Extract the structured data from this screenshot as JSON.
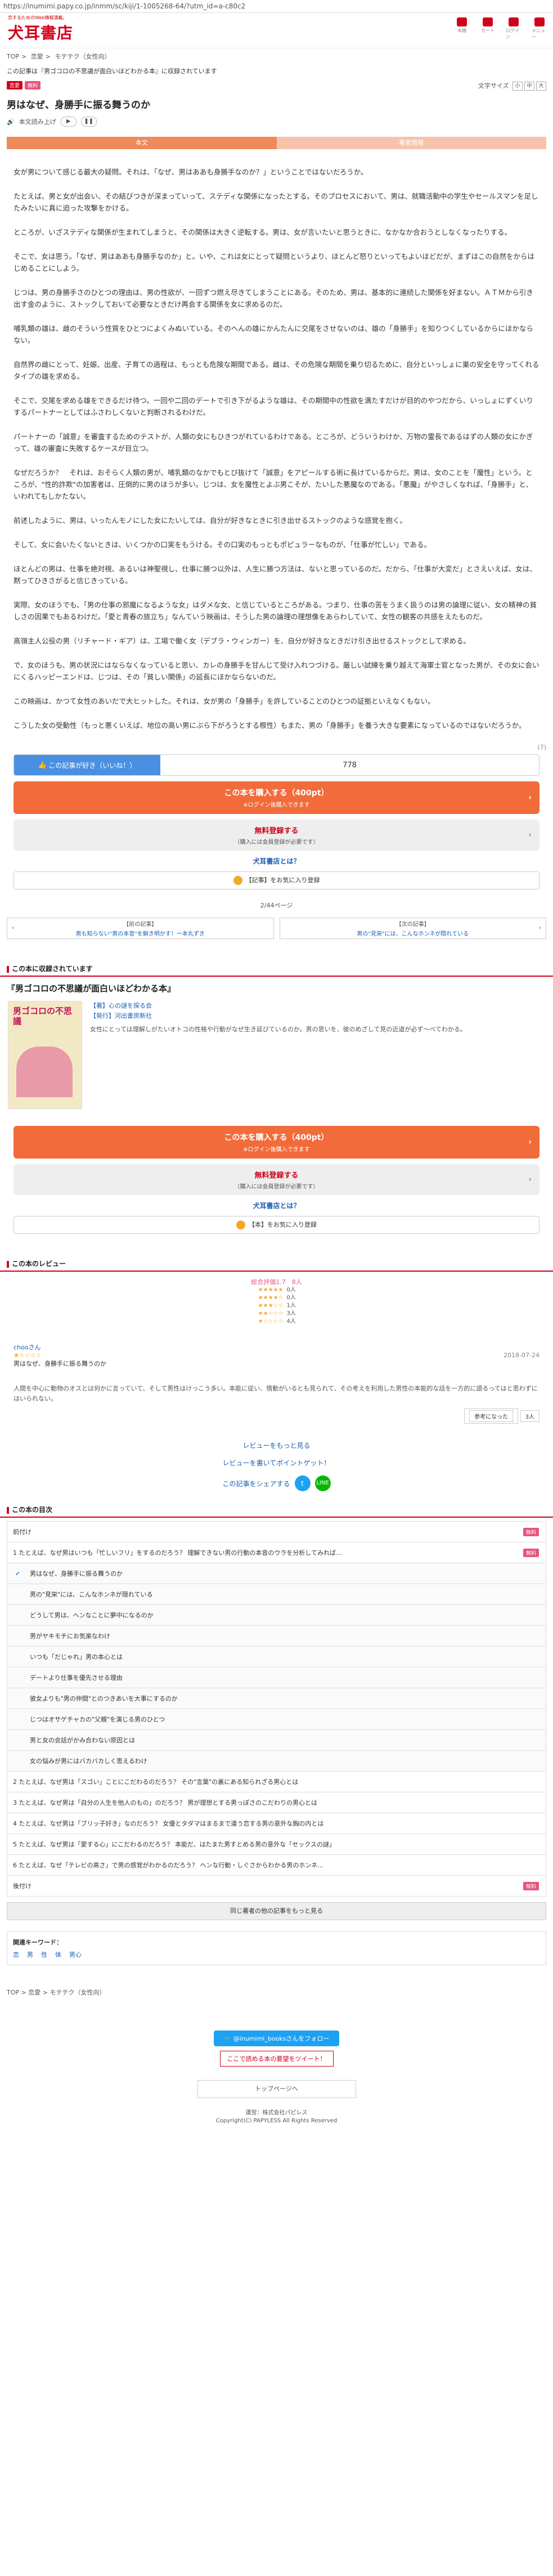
{
  "url": "https://inumimi.papy.co.jp/inmm/sc/kiji/1-1005268-64/?utm_id=a-c80c2",
  "header": {
    "tagline": "恋するためのWeb情報満載。",
    "logo": "犬耳書店",
    "icons": [
      {
        "name": "bookshelf-icon",
        "label": "本棚"
      },
      {
        "name": "cart-icon",
        "label": "カート"
      },
      {
        "name": "login-icon",
        "label": "ログイン"
      },
      {
        "name": "menu-icon",
        "label": "メニュー"
      }
    ]
  },
  "breadcrumb": [
    "TOP",
    "恋愛",
    "モテテク（女性向）"
  ],
  "notice": "この記事は『男ゴコロの不思議が面白いほどわかる本』に収録されています",
  "tags": [
    "恋愛",
    "無料"
  ],
  "font_size": {
    "label": "文字サイズ",
    "options": [
      "小",
      "中",
      "大"
    ]
  },
  "article": {
    "title": "男はなぜ、身勝手に振る舞うのか",
    "audio_label": "本文読み上げ",
    "tabs": [
      "本文",
      "著者情報"
    ],
    "paragraphs": [
      "女が男について感じる最大の疑問。それは、「なぜ、男はああも身勝手なのか？」ということではないだろうか。",
      "たとえば、男と女が出会い、その結びつきが深まっていって、ステディな関係になったとする。そのプロセスにおいて、男は、就職活動中の学生やセールスマンを足したみたいに真に迫った攻撃をかける。",
      "ところが、いざステディな関係が生まれてしまうと、その関係は大きく逆転する。男は、女が言いたいと思うときに、なかなか合おうとしなくなったりする。",
      "そこで、女は思う。「なぜ、男はああも身勝手なのか」と。いや、これは女にとって疑問というより、ほとんど怒りといってもよいほどだが、まずはこの自然をからはじめることにしよう。",
      "じつは、男の身勝手さのひとつの理由は、男の性欲が、一回ずつ燃え尽きてしまうことにある。そのため、男は、基本的に連続した関係を好まない。ＡＴＭから引き出す金のように、ストックしておいて必要なときだけ再会する関係を女に求めるのだ。",
      "哺乳類の雄は、雌のそういう性質をひとつによくみぬいている。そのへんの雄にかんたんに交尾をさせないのは、雄の「身勝手」を知りつくしているからにほかならない。",
      "自然界の雌にとって、妊娠、出産、子育ての過程は、もっとも危険な期間である。雌は、その危険な期間を乗り切るために、自分といっしょに巣の安全を守ってくれるタイプの雄を求める。",
      "そこで、交尾を求める雄をできるだけ待つ。一回や二回のデートで引き下がるような雄は、その期間中の性欲を満たすだけが目的のやつだから、いっしょにずくいりするパートナーとしてはふさわしくないと判断されるわけだ。",
      "パートナーの「誠意」を審査するためのテストが、人類の女にもひきつがれているわけである。ところが、どういうわけか、万物の霊長であるはずの人類の女にかぎって、雄の審査に失敗するケースが目立つ。",
      "なぜだろうか？　それは、おそらく人類の男が、哺乳類のなかでもとび抜けて「誠意」をアピールする術に長けているからだ。男は、女のことを「魔性」という。ところが、\"性的詐欺\"の加害者は、圧倒的に男のほうが多い。じつは、女を魔性とよぶ男こそが、たいした悪魔なのである。「悪魔」がやさしくなれば、「身勝手」と、いわれてもしかたない。",
      "前述したように、男は、いったんモノにした女にたいしては、自分が好きなときに引き出せるストックのような感覚を抱く。",
      "そして、女に会いたくないときは、いくつかの口実をもうける。その口実のもっともポピュラーなものが、「仕事が忙しい」である。",
      "ほとんどの男は、仕事を絶対視、あるいは神聖視し、仕事に勝つ以外は、人生に勝つ方法は、ないと思っているのだ。だから、「仕事が大変だ」とさえいえば、女は、黙ってひきさがると信じきっている。",
      "実際、女のほうでも、「男の仕事の邪魔になるような女」はダメな女、と信じているところがある。つまり、仕事の苦をうまく扱うのは男の論理に従い、女の精神の貧しさの因果でもあるわけだ。「愛と青春の旅立ち」なんていう映画は、そうした男の論理の理想像をあらわしていて、女性の観客の共感をえたものだ。",
      "高嶺主人公役の男（リチャード・ギア）は、工場で働く女（デブラ・ウィンガー）を、自分が好きなときだけ引き出せるストックとして求める。",
      "で、女のほうも、男の状況にはならなくなっていると思い、カレの身勝手を甘んじて受け入れつづける。厳しい試練を乗り越えて海軍士官となった男が、その女に会いにくるハッピーエンドは、じつは、その「貧しい関係」の延長にほかならないのだ。",
      "この映画は、かつて女性のあいだで大ヒットした。それは、女が男の「身勝手」を許していることのひとつの証拠といえなくもない。",
      "こうした女の受動性（もっと悪くいえば、地位の高い男にぶら下がろうとする根性）もまた、男の「身勝手」を養う大きな要素になっているのではないだろうか。"
    ],
    "page_indicator": "(7)",
    "like_label": "この記事が好き（いいね！）",
    "like_count": "778"
  },
  "purchase": {
    "buy_label": "この本を購入する（400pt）",
    "buy_sub": "※ログイン後購入できます",
    "free_label": "無料登録する",
    "free_sub": "（購入には会員登録が必要です）",
    "what_is": "犬耳書店とは？",
    "fav_article": "【記事】をお気に入り登録",
    "fav_book": "【本】をお気に入り登録"
  },
  "pagination": "2/44ページ",
  "prev": {
    "label": "【前の記事】",
    "title": "男も知らない\"男の本音\"を解き明かす！一本丸ずき"
  },
  "next": {
    "label": "【次の記事】",
    "title": "男の\"見栄\"には、こんなホンネが隠れている"
  },
  "book_section": {
    "heading": "この本に収録されています",
    "title": "『男ゴコロの不思議が面白いほどわかる本』",
    "cover_title": "男ゴコロの不思議",
    "author": "【著】心の謎を探る会",
    "publisher": "【発行】河出書房新社",
    "description": "女性にとっては理解しがたいオトコの性格や行動がなぜ生き延びているのか。男の思いを、彼のめざして見の近道が必ず～べてわかる。"
  },
  "reviews": {
    "heading": "この本のレビュー",
    "summary": "総合評価1.7　8人",
    "breakdown": [
      {
        "stars": "★★★★★",
        "count": "0人"
      },
      {
        "stars": "★★★★☆",
        "count": "0人"
      },
      {
        "stars": "★★★☆☆",
        "count": "1人"
      },
      {
        "stars": "★★☆☆☆",
        "count": "3人"
      },
      {
        "stars": "★☆☆☆☆",
        "count": "4人"
      }
    ],
    "item": {
      "user": "chooさん",
      "stars": "★☆☆☆☆",
      "date": "2018-07-24",
      "headline": "男はなぜ、身勝手に振る舞うのか",
      "body": "人間を中心に動物のオスとは何かに言っていて、そして男性はけっこう多い。本能に従い、情動がいるとも見られて、その考えを利用した男性の本能的な話を一方的に語るってはと思わずにはいられない。",
      "helpful": "参考になった",
      "helpful_count": "3人"
    },
    "more_link": "レビューをもっと見る",
    "write_link": "レビューを書いてポイントゲット！",
    "share_label": "この記事をシェアする"
  },
  "toc": {
    "heading": "この本の目次",
    "rows": [
      {
        "title": "前付け",
        "level": 0,
        "badge": "無料"
      },
      {
        "title": "1 たとえば、なぜ男はいつも「忙しいフリ」をするのだろう？ 理解できない男の行動の本音のウラを分析してみれば…",
        "level": 0,
        "badge": "無料"
      },
      {
        "title": "男はなぜ、身勝手に振る舞うのか",
        "level": 1,
        "checked": true,
        "badge": ""
      },
      {
        "title": "男の\"見栄\"には、こんなホンネが隠れている",
        "level": 1,
        "badge": ""
      },
      {
        "title": "どうして男は、ヘンなことに夢中になるのか",
        "level": 1,
        "badge": ""
      },
      {
        "title": "男がヤキモチにお気楽なわけ",
        "level": 1,
        "badge": ""
      },
      {
        "title": "いつも「だじゃれ」男の本心とは",
        "level": 1,
        "badge": ""
      },
      {
        "title": "デートより仕事を優先させる理由",
        "level": 1,
        "badge": ""
      },
      {
        "title": "彼女よりも\"男の仲間\"とのつきあいを大事にするのか",
        "level": 1,
        "badge": ""
      },
      {
        "title": "じつはオサゲチャカの\"父親\"を演じる男のひとつ",
        "level": 1,
        "badge": ""
      },
      {
        "title": "男と女の会話がかみ合わない原因とは",
        "level": 1,
        "badge": ""
      },
      {
        "title": "女の悩みが男にはバカバカしく思えるわけ",
        "level": 1,
        "badge": ""
      },
      {
        "title": "2 たとえば、なぜ男は「スゴい」ことにこだわるのだろう？ その\"言葉\"の裏にある知られざる男心とは",
        "level": 0,
        "badge": ""
      },
      {
        "title": "3 たとえば、なぜ男は「自分の人生を他人のもの」のだろう？ 男が理想とする男っぽさのこだわりの男心とは",
        "level": 0,
        "badge": ""
      },
      {
        "title": "4 たとえば、なぜ男は「ブリッ子好き」なのだろう？ 女優とタダマはまるまで違う恋する男の意外な胸の内とは",
        "level": 0,
        "badge": ""
      },
      {
        "title": "5 たとえば、なぜ男は「愛する心」にこだわるのだろう？ 本能だ、はたまた男すとめる男の意外な「セックスの謎」",
        "level": 0,
        "badge": ""
      },
      {
        "title": "6 たとえば、なぜ「テレビの高さ」で男の感覚がわかるのだろう？ ヘンな行動・しぐさからわかる男のホンネ…",
        "level": 0,
        "badge": ""
      },
      {
        "title": "後付け",
        "level": 0,
        "badge": "無料"
      }
    ],
    "same_category": "同じ著者の他の記事をもっと見る"
  },
  "keywords": {
    "heading": "関連キーワード：",
    "items": [
      "恋",
      "男",
      "性",
      "体",
      "男心"
    ]
  },
  "footer": {
    "breadcrumb": [
      "TOP",
      "恋愛",
      "モテテク（女性向）"
    ],
    "twitter_follow": "@inumimi_booksさんをフォロー",
    "request": "ここで読める本の要望をツイート！",
    "top_button": "トップページへ",
    "company": "運営：株式会社パピレス",
    "copyright": "Copyright(C) PAPYLESS All Rights Reserved"
  }
}
